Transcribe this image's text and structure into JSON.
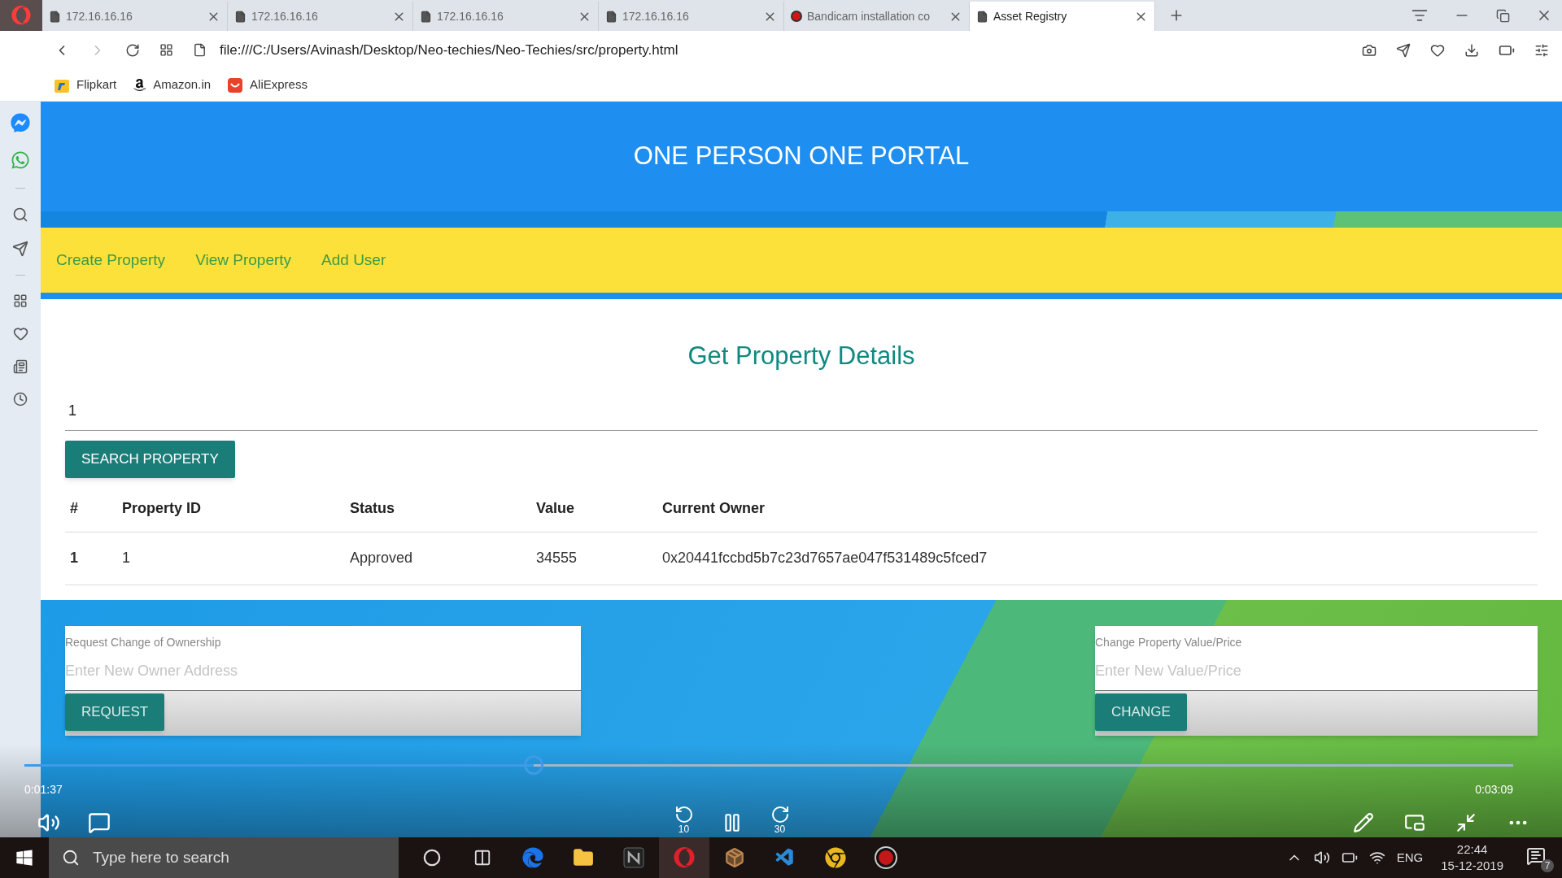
{
  "browser": {
    "tabs": [
      {
        "title": "172.16.16.16",
        "kind": "page",
        "selected": false
      },
      {
        "title": "172.16.16.16",
        "kind": "page",
        "selected": false
      },
      {
        "title": "172.16.16.16",
        "kind": "page",
        "selected": false
      },
      {
        "title": "172.16.16.16",
        "kind": "page",
        "selected": false
      },
      {
        "title": "Bandicam installation co",
        "kind": "recording",
        "selected": false
      },
      {
        "title": "Asset Registry",
        "kind": "page",
        "selected": true
      }
    ],
    "address": "file:///C:/Users/Avinash/Desktop/Neo-techies/Neo-Techies/src/property.html",
    "bookmarks": [
      {
        "label": "Flipkart",
        "kind": "flipkart"
      },
      {
        "label": "Amazon.in",
        "kind": "amazon"
      },
      {
        "label": "AliExpress",
        "kind": "aliexpress"
      }
    ]
  },
  "page": {
    "header": "ONE PERSON ONE PORTAL",
    "nav": [
      "Create Property",
      "View Property",
      "Add User"
    ],
    "heading": "Get Property Details",
    "search": {
      "value": "1"
    },
    "search_button": "SEARCH PROPERTY",
    "table": {
      "columns": [
        "#",
        "Property ID",
        "Status",
        "Value",
        "Current Owner"
      ],
      "rows": [
        [
          "1",
          "1",
          "Approved",
          "34555",
          "0x20441fccbd5b7c23d7657ae047f531489c5fced7"
        ]
      ]
    },
    "forms": [
      {
        "label": "Request Change of Ownership",
        "placeholder": "Enter New Owner Address",
        "button": "REQUEST"
      },
      {
        "label": "Change Property Value/Price",
        "placeholder": "Enter New Value/Price",
        "button": "CHANGE"
      }
    ]
  },
  "player": {
    "elapsed": "0:01:37",
    "total": "0:03:09",
    "level": 0.342,
    "skip_back": "10",
    "skip_forward": "30"
  },
  "taskbar": {
    "search": {
      "placeholder": "Type here to search"
    },
    "apps": [
      {
        "kind": "cortana",
        "selected": false
      },
      {
        "kind": "taskview",
        "selected": false
      },
      {
        "kind": "edge",
        "selected": false
      },
      {
        "kind": "folder",
        "selected": false
      },
      {
        "kind": "notes",
        "selected": false
      },
      {
        "kind": "opera",
        "selected": true
      },
      {
        "kind": "package",
        "selected": false
      },
      {
        "kind": "code",
        "selected": false
      },
      {
        "kind": "chrome",
        "selected": false
      },
      {
        "kind": "record",
        "selected": false
      }
    ],
    "language": "ENG",
    "time": "22:44",
    "date": "15-12-2019",
    "notifications": "7"
  }
}
